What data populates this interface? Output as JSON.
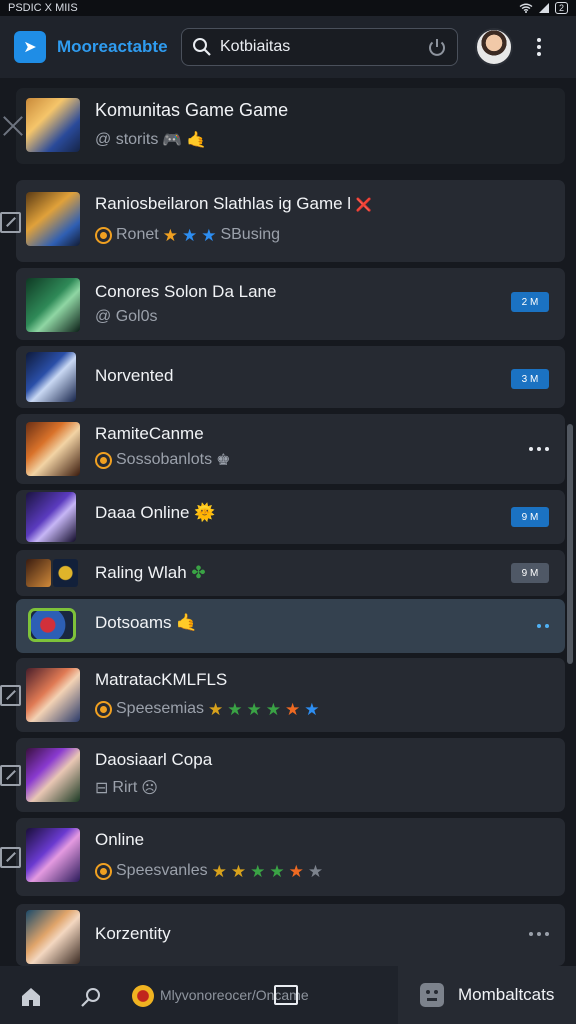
{
  "status_bar": {
    "left_text": "PSDIC X MIIS",
    "battery_text": "2"
  },
  "app_bar": {
    "title": "Mooreactabte",
    "search_placeholder": "Kotbiaitas",
    "logo_glyph": "➤"
  },
  "pinned_card": {
    "title": "Komunitas Game Game",
    "subtitle": "@ storits",
    "emoji": "🎮 🤙"
  },
  "items": [
    {
      "title": "Raniosbeilaron Slathlas ig Game l",
      "subtitle": "Ronet",
      "subtitle_icon": "coin-icon",
      "stars": [
        "#f0a021",
        "#2d8ef2",
        "#2d8ef2"
      ],
      "after": "SBusing",
      "title_emoji": "❌",
      "action": "external-link"
    },
    {
      "title": "Conores Solon Da Lane",
      "subtitle": "@ Gol0s",
      "action_badge": "2 M",
      "action": "badge"
    },
    {
      "title": "Norvented",
      "action_badge": "3 M",
      "action": "badge"
    },
    {
      "title": "RamiteCanme",
      "subtitle": "Sossobanlots",
      "subtitle_icon": "coin-icon",
      "action": "more"
    },
    {
      "title": "Daaa Online",
      "title_emoji": "🌞",
      "action_badge": "9 M",
      "action": "badge"
    },
    {
      "title": "Raling Wlah",
      "title_emoji": "✤",
      "action_badge": "9 M",
      "action": "badge-dim"
    },
    {
      "title": "Dotsoams",
      "title_emoji": "🤙",
      "action": "more-blue"
    },
    {
      "title": "MatratacKMLFLS",
      "subtitle": "Speesemias",
      "subtitle_icon": "coin-icon",
      "stars": [
        "#d8a21c",
        "#3aa345",
        "#3aa345",
        "#3aa345",
        "#ef6a22",
        "#2d8ef2"
      ],
      "action": "external-link"
    },
    {
      "title": "Daosiaarl Copa",
      "subtitle": "Rirt",
      "action": "external-link"
    },
    {
      "title": "Online",
      "subtitle": "Speesvanles",
      "subtitle_icon": "coin-icon",
      "stars": [
        "#d8a21c",
        "#d8a21c",
        "#3aa345",
        "#3aa345",
        "#ef6a22",
        "#7c828c"
      ],
      "action": "external-link"
    },
    {
      "title": "Korzentity",
      "action": "more-grey"
    }
  ],
  "bottom_nav": {
    "center_label": "Mlyvonoreocer/Oncame",
    "active_label": "Mombaltcats"
  },
  "colors": {
    "accent": "#2f9cf0",
    "badge": "#1b72c2",
    "highlight_row": "#34414f"
  }
}
